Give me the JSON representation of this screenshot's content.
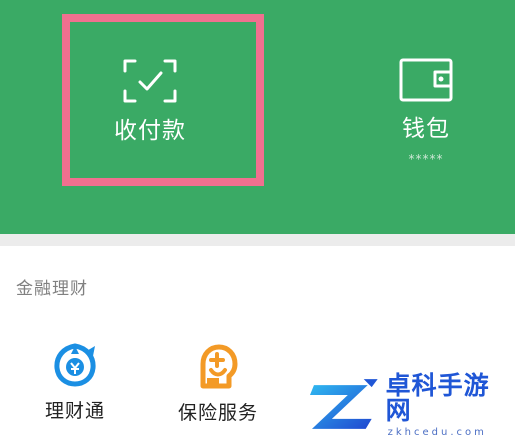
{
  "top_panel": {
    "color": "#3aaa65",
    "highlight_color": "#f0708f",
    "tiles": [
      {
        "label": "收付款",
        "icon": "scan-check-icon"
      },
      {
        "label": "钱包",
        "sublabel": "*****",
        "icon": "wallet-icon"
      }
    ]
  },
  "finance": {
    "title": "金融理财",
    "items": [
      {
        "label": "理财通",
        "icon": "licaitong-icon"
      },
      {
        "label": "保险服务",
        "icon": "insurance-icon"
      }
    ]
  },
  "watermark": {
    "text": "卓科手游网",
    "sub": "zkhcedu.com"
  }
}
